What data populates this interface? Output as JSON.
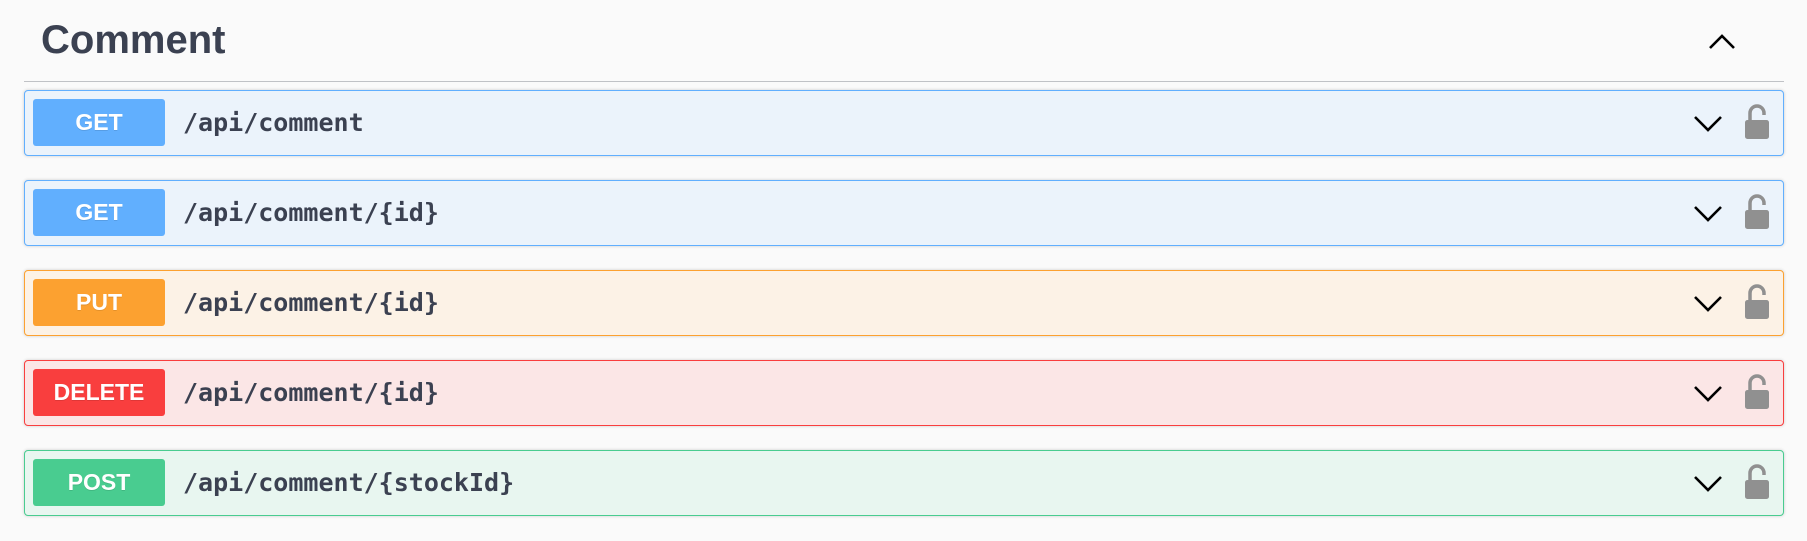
{
  "section": {
    "title": "Comment"
  },
  "operations": [
    {
      "method": "GET",
      "path": "/api/comment",
      "colors": {
        "badge": "#61affe",
        "bg": "#ebf3fb",
        "border": "#61affe"
      }
    },
    {
      "method": "GET",
      "path": "/api/comment/{id}",
      "colors": {
        "badge": "#61affe",
        "bg": "#ebf3fb",
        "border": "#61affe"
      }
    },
    {
      "method": "PUT",
      "path": "/api/comment/{id}",
      "colors": {
        "badge": "#fca130",
        "bg": "#fcf2e6",
        "border": "#fca130"
      }
    },
    {
      "method": "DELETE",
      "path": "/api/comment/{id}",
      "colors": {
        "badge": "#f93e3e",
        "bg": "#fbe6e6",
        "border": "#f93e3e"
      }
    },
    {
      "method": "POST",
      "path": "/api/comment/{stockId}",
      "colors": {
        "badge": "#49cc90",
        "bg": "#e8f6f0",
        "border": "#49cc90"
      }
    }
  ],
  "icons": {
    "collapse": "chevron-up-icon",
    "expand": "chevron-down-icon",
    "auth": "unlocked-padlock-icon"
  }
}
